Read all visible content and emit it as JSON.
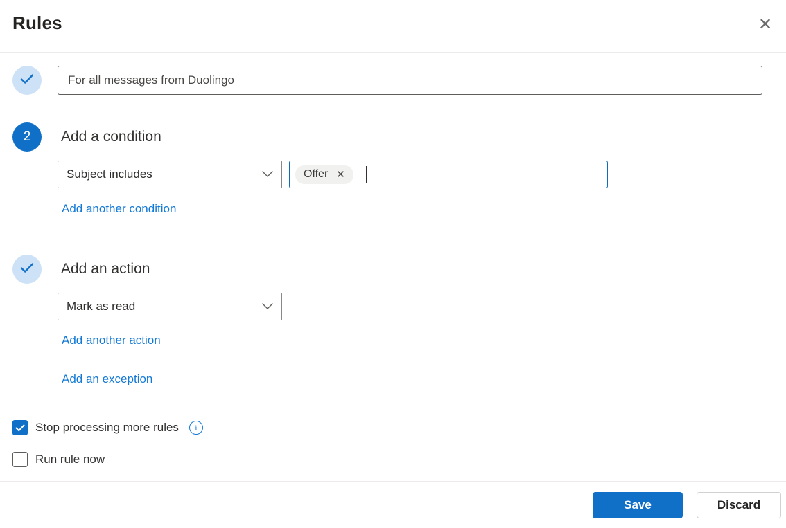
{
  "dialog": {
    "title": "Rules"
  },
  "icons": {
    "close": "✕",
    "tag_remove": "✕",
    "info": "i"
  },
  "rule_name": {
    "step_state": "complete",
    "value": "For all messages from Duolingo"
  },
  "condition_section": {
    "step_number": "2",
    "heading": "Add a condition",
    "dropdown_value": "Subject includes",
    "tag_value": "Offer",
    "add_link": "Add another condition"
  },
  "action_section": {
    "step_state": "complete",
    "heading": "Add an action",
    "dropdown_value": "Mark as read",
    "add_link": "Add another action",
    "exception_link": "Add an exception"
  },
  "options": {
    "stop_processing": {
      "label": "Stop processing more rules",
      "checked": true
    },
    "run_now": {
      "label": "Run rule now",
      "checked": false
    }
  },
  "footer": {
    "save_label": "Save",
    "discard_label": "Discard"
  },
  "colors": {
    "primary": "#1070c8",
    "link": "#1279d7",
    "step_complete_bg": "#cde1f7",
    "focus_border": "#0f6cbd"
  }
}
